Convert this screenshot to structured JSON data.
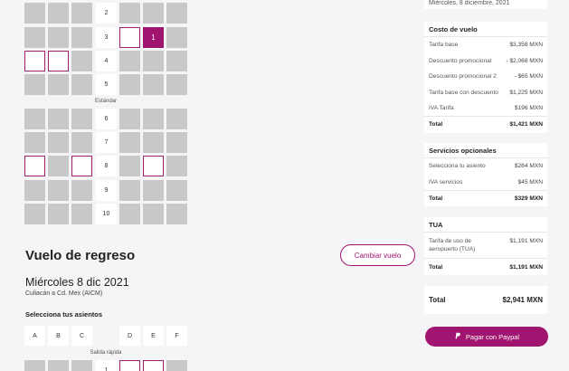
{
  "header": {
    "outbound_date": "Miércoles, 8 diciembre, 2021"
  },
  "seatmap": {
    "rows": [
      "2",
      "3",
      "4",
      "5",
      "6",
      "7",
      "8",
      "9",
      "10"
    ],
    "section_label": "Estándar",
    "selected_seat_label": "1"
  },
  "return_flight": {
    "title": "Vuelo de regreso",
    "change_button": "Cambiar vuelo",
    "date": "Miércoles 8 dic 2021",
    "route": "Culiacán a Cd. Mex (AICM)",
    "seats_label": "Selecciona tus asientos",
    "columns": [
      "A",
      "B",
      "C",
      "D",
      "E",
      "F"
    ],
    "section_label": "Salida rápida",
    "first_row": "1"
  },
  "summary": {
    "flight_cost": {
      "title": "Costo de vuelo",
      "lines": [
        {
          "label": "Tarifa base",
          "value": "$3,358 MXN"
        },
        {
          "label": "Descuento promocional",
          "value": "- $2,068 MXN"
        },
        {
          "label": "Descuento promocional 2",
          "value": "- $65 MXN"
        },
        {
          "label": "Tarifa base con descuento",
          "value": "$1,225 MXN"
        },
        {
          "label": "IVA Tarifa",
          "value": "$196 MXN"
        }
      ],
      "total_label": "Total",
      "total_value": "$1,421 MXN"
    },
    "optional_services": {
      "title": "Servicios opcionales",
      "lines": [
        {
          "label": "Selecciona tu asiento",
          "value": "$284 MXN"
        },
        {
          "label": "IVA servicios",
          "value": "$45 MXN"
        }
      ],
      "total_label": "Total",
      "total_value": "$329 MXN"
    },
    "tua": {
      "title": "TUA",
      "lines": [
        {
          "label": "Tarifa de uso de aeropuerto (TUA)",
          "value": "$1,191 MXN"
        }
      ],
      "total_label": "Total",
      "total_value": "$1,191 MXN"
    },
    "grand_total_label": "Total",
    "grand_total_value": "$2,941 MXN",
    "pay_button": "Pagar con Paypal"
  },
  "colors": {
    "accent": "#a0156f",
    "occupied_seat": "#c8c8cb",
    "background": "#f5f4f6"
  },
  "icons": [
    "paypal-icon"
  ]
}
